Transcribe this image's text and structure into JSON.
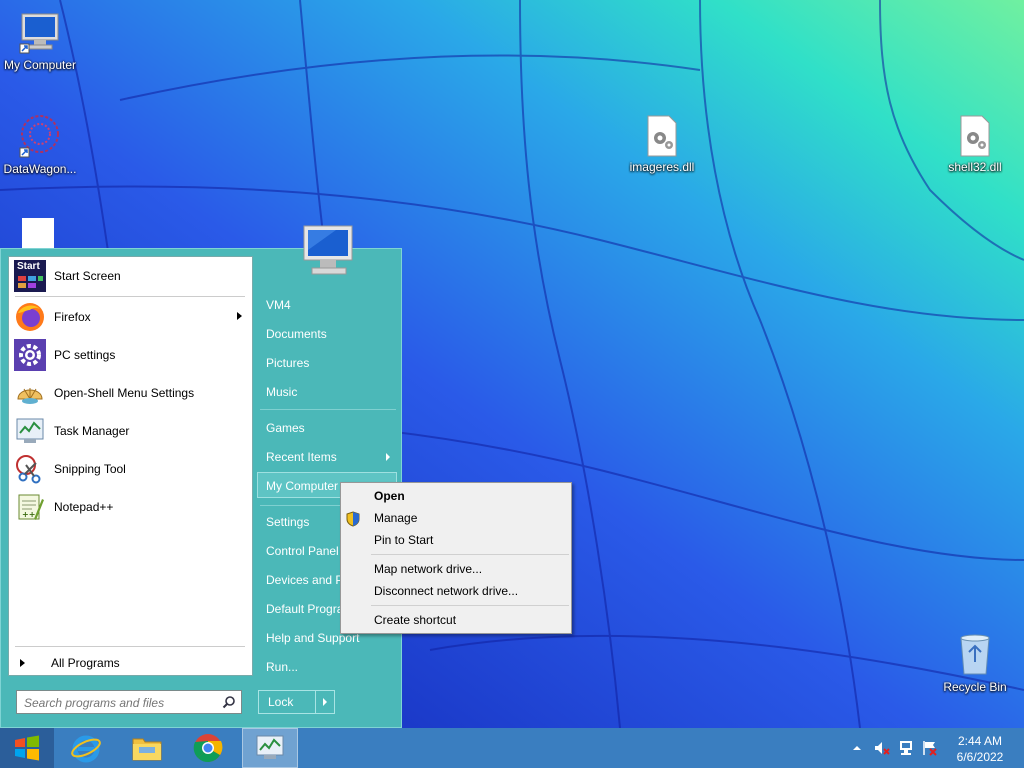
{
  "desktop": {
    "icons": [
      {
        "label": "My Computer"
      },
      {
        "label": "DataWagon..."
      },
      {
        "label": "imageres.dll"
      },
      {
        "label": "shell32.dll"
      },
      {
        "label": "Recycle Bin"
      }
    ]
  },
  "start_menu": {
    "logo_text": "Start",
    "programs": [
      {
        "label": "Start Screen"
      },
      {
        "label": "Firefox",
        "has_submenu": true
      },
      {
        "label": "PC settings"
      },
      {
        "label": "Open-Shell Menu Settings"
      },
      {
        "label": "Task Manager"
      },
      {
        "label": "Snipping Tool"
      },
      {
        "label": "Notepad++"
      }
    ],
    "all_programs": "All Programs",
    "search_placeholder": "Search programs and files",
    "right_items": [
      {
        "label": "VM4"
      },
      {
        "label": "Documents"
      },
      {
        "label": "Pictures"
      },
      {
        "label": "Music"
      },
      {
        "label": "Games"
      },
      {
        "label": "Recent Items",
        "has_submenu": true
      },
      {
        "label": "My Computer",
        "selected": true
      },
      {
        "label": "Settings"
      },
      {
        "label": "Control Panel"
      },
      {
        "label": "Devices and P"
      },
      {
        "label": "Default Progra"
      },
      {
        "label": "Help and Support"
      },
      {
        "label": "Run..."
      }
    ],
    "lock_label": "Lock"
  },
  "context_menu": {
    "items": [
      {
        "label": "Open",
        "bold": true
      },
      {
        "label": "Manage",
        "icon": "uac-shield-icon"
      },
      {
        "label": "Pin to Start"
      },
      {
        "label": "Map network drive..."
      },
      {
        "label": "Disconnect network drive..."
      },
      {
        "label": "Create shortcut"
      }
    ]
  },
  "taskbar": {
    "pinned": [
      "start-orb-icon",
      "internet-explorer-icon",
      "file-explorer-icon",
      "chrome-icon",
      "my-computer-icon"
    ],
    "clock": {
      "time": "2:44 AM",
      "date": "6/6/2022"
    }
  },
  "colors": {
    "start_menu_bg": "#4bb8b8",
    "taskbar_bg": "#3a7ec0",
    "context_bg": "#f0f0f0"
  }
}
